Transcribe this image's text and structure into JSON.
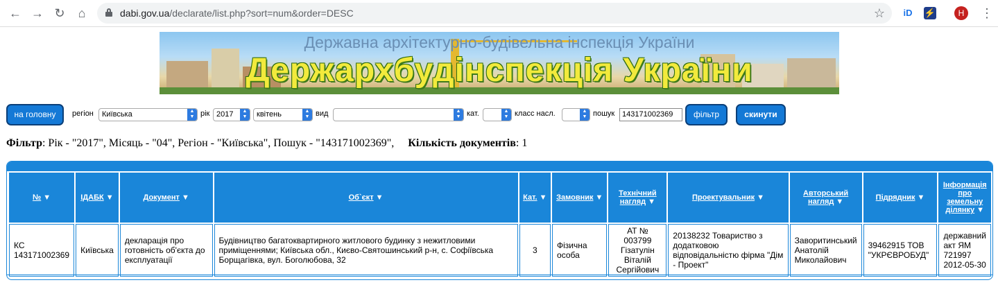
{
  "browser": {
    "url_domain": "dabi.gov.ua",
    "url_path": "/declarate/list.php?sort=num&order=DESC",
    "profile_initial": "Н"
  },
  "banner": {
    "subtitle": "Державна архітектурно-будівельна інспекція України",
    "title": "Держархбудінспекція України"
  },
  "filter_bar": {
    "home_button": "на головну",
    "region_label": "регіон",
    "region_value": "Київська",
    "year_label": "рік",
    "year_value": "2017",
    "month_value": "квітень",
    "type_label": "вид",
    "type_value": "",
    "category_label": "кат.",
    "category_value": "",
    "class_label": "класс насл.",
    "class_value": "",
    "search_label": "пошук",
    "search_value": "143171002369",
    "filter_button": "фільтр",
    "reset_button": "скинути"
  },
  "summary": {
    "filter_label": "Фільтр",
    "filter_text": ": Рік - \"2017\", Місяць - \"04\", Регіон - \"Київська\", Пошук - \"143171002369\",",
    "count_label": "Кількість документів",
    "count_value": ": 1"
  },
  "table": {
    "headers": [
      "№",
      "ІДАБК",
      "Документ",
      "Об`єкт",
      "Кат.",
      "Замовник",
      "Технічний нагляд",
      "Проектувальник",
      "Авторський нагляд",
      "Підрядник",
      "Інформація про земельну ділянку"
    ],
    "rows": [
      [
        "КС 143171002369",
        "Київська",
        "декларація про готовність об'єкта до експлуатації",
        "Будівництво багатоквартирного житлового будинку з нежитловими приміщеннями; Київська обл., Києво-Святошинський р-н, с. Софіївська Борщагівка, вул. Боголюбова, 32",
        "3",
        "Фізична особа",
        "АТ № 003799 Гізатулін Віталій Сергійович",
        "20138232 Товариство з додатковою відповідальністю фірма \"Дім - Проект\"",
        "Заворитинський Анатолій Миколайович",
        "39462915 ТОВ \"УКРЄВРОБУД\"",
        "державний акт ЯМ 721997 2012-05-30"
      ]
    ]
  },
  "colors": {
    "accent": "#1a86d9",
    "button": "#1479d6",
    "banner_title": "#f2ea3c"
  }
}
